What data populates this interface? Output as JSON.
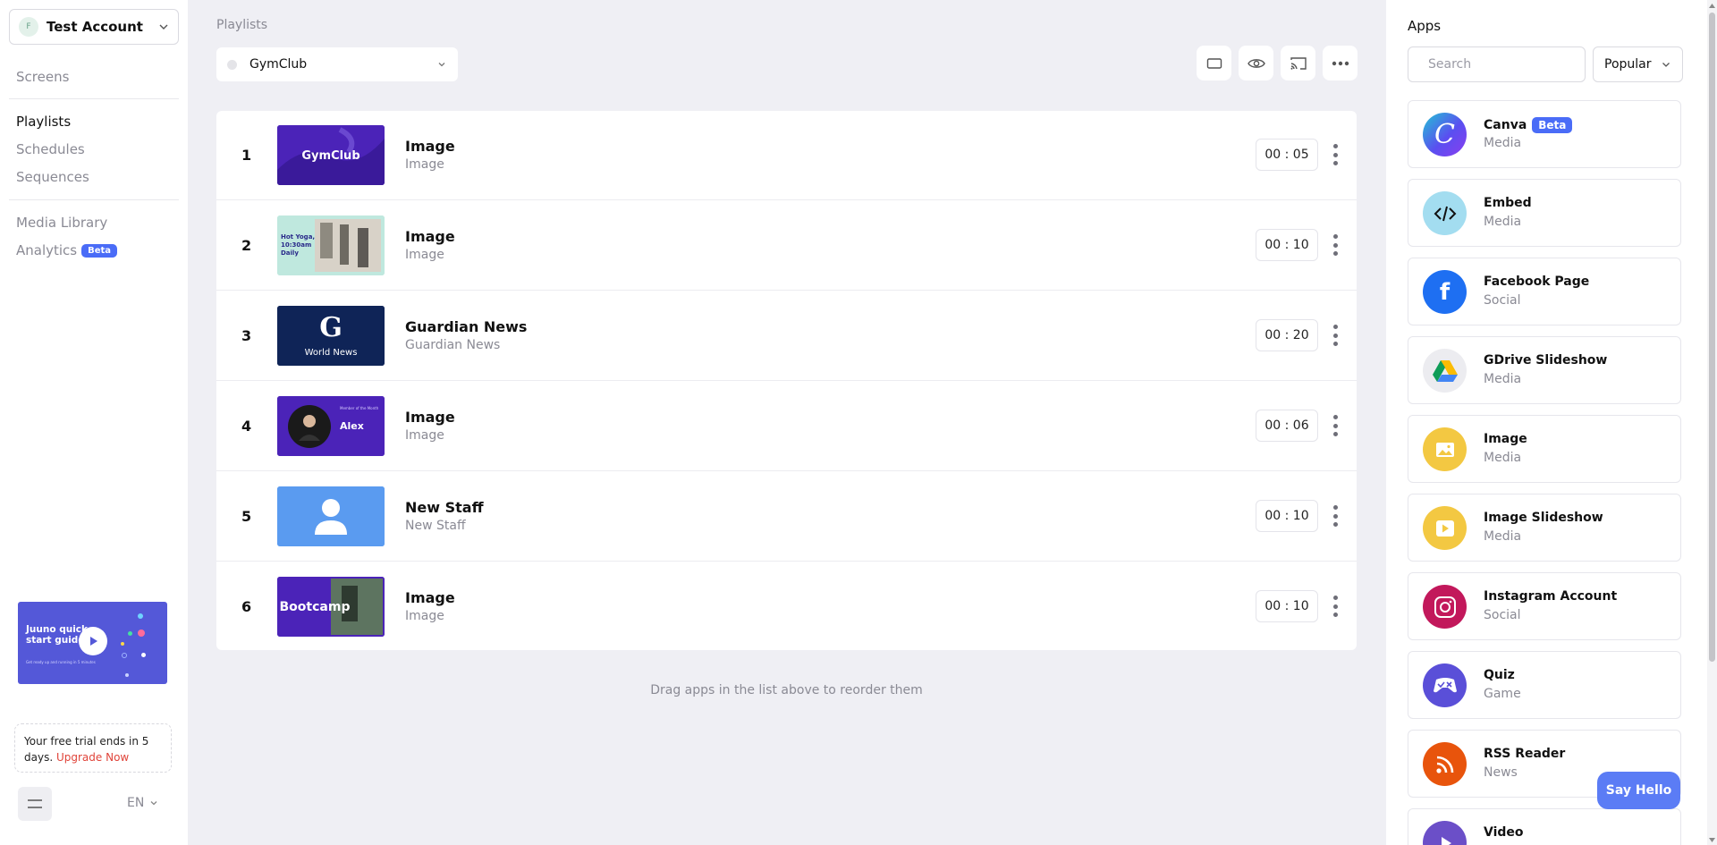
{
  "account": {
    "initial": "F",
    "name": "Test Account"
  },
  "nav": {
    "screens": "Screens",
    "playlists": "Playlists",
    "schedules": "Schedules",
    "sequences": "Sequences",
    "media_library": "Media Library",
    "analytics": "Analytics",
    "analytics_badge": "Beta"
  },
  "guide": {
    "title": "Juuno quick start guide",
    "sub": "Get ready up and running in 5 minutes"
  },
  "trial": {
    "text": "Your free trial ends in 5 days.",
    "link": "Upgrade Now"
  },
  "language": "EN",
  "main": {
    "page_label": "Playlists",
    "playlist_name": "GymClub",
    "hint": "Drag apps in the list above to reorder them"
  },
  "playlist_items": [
    {
      "num": "1",
      "title": "Image",
      "sub": "Image",
      "duration": "00 : 05",
      "thumb_text": "GymClub"
    },
    {
      "num": "2",
      "title": "Image",
      "sub": "Image",
      "duration": "00 : 10",
      "thumb_text": "Hot Yoga, 10:30am Daily"
    },
    {
      "num": "3",
      "title": "Guardian News",
      "sub": "Guardian News",
      "duration": "00 : 20",
      "thumb_text": "World News",
      "thumb_glyph": "G"
    },
    {
      "num": "4",
      "title": "Image",
      "sub": "Image",
      "duration": "00 : 06",
      "thumb_text": "Alex",
      "thumb_caption": "Member of the Month"
    },
    {
      "num": "5",
      "title": "New Staff",
      "sub": "New Staff",
      "duration": "00 : 10"
    },
    {
      "num": "6",
      "title": "Image",
      "sub": "Image",
      "duration": "00 : 10",
      "thumb_text": "Bootcamp"
    }
  ],
  "apps_panel": {
    "title": "Apps",
    "search_placeholder": "Search",
    "sort": "Popular",
    "items": [
      {
        "name": "Canva",
        "badge": "Beta",
        "category": "Media",
        "icon": "canva-icon"
      },
      {
        "name": "Embed",
        "category": "Media",
        "icon": "code-icon"
      },
      {
        "name": "Facebook Page",
        "category": "Social",
        "icon": "facebook-icon"
      },
      {
        "name": "GDrive Slideshow",
        "category": "Media",
        "icon": "gdrive-icon"
      },
      {
        "name": "Image",
        "category": "Media",
        "icon": "image-icon"
      },
      {
        "name": "Image Slideshow",
        "category": "Media",
        "icon": "slideshow-icon"
      },
      {
        "name": "Instagram Account",
        "category": "Social",
        "icon": "instagram-icon"
      },
      {
        "name": "Quiz",
        "category": "Game",
        "icon": "quiz-icon"
      },
      {
        "name": "RSS Reader",
        "category": "News",
        "icon": "rss-icon"
      },
      {
        "name": "Video",
        "category": "",
        "icon": "video-icon"
      }
    ]
  },
  "say_hello": "Say Hello",
  "colors": {
    "accent": "#4a6cf7",
    "link_red": "#e0443a",
    "gym_purple": "#4b23b8"
  }
}
